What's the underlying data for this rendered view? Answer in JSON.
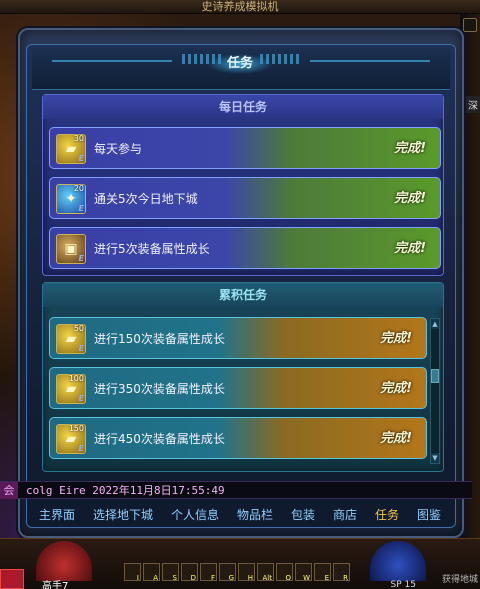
{
  "app": {
    "title": "史诗养成模拟机"
  },
  "panel": {
    "title": "任务"
  },
  "daily": {
    "title": "每日任务",
    "tasks": [
      {
        "icon": "gold-ingot-icon",
        "count": "30",
        "name": "每天参与",
        "status": "完成!"
      },
      {
        "icon": "blue-dungeon-icon",
        "count": "20",
        "name": "通关5次今日地下城",
        "status": "完成!"
      },
      {
        "icon": "equipment-box-icon",
        "count": "",
        "name": "进行5次装备属性成长",
        "status": "完成!"
      }
    ]
  },
  "accum": {
    "title": "累积任务",
    "tasks": [
      {
        "icon": "gold-ingot-icon",
        "count": "50",
        "name": "进行150次装备属性成长",
        "status": "完成!"
      },
      {
        "icon": "gold-ingot-icon",
        "count": "100",
        "name": "进行350次装备属性成长",
        "status": "完成!"
      },
      {
        "icon": "gold-ingot-icon",
        "count": "150",
        "name": "进行450次装备属性成长",
        "status": "完成!"
      }
    ]
  },
  "chat": {
    "tag": "会",
    "message": "colg Eire 2022年11月8日17:55:49"
  },
  "nav": {
    "items": [
      "主界面",
      "选择地下城",
      "个人信息",
      "物品栏",
      "包装",
      "商店",
      "任务",
      "图鉴"
    ],
    "active": "任务"
  },
  "hud": {
    "player": "高手7",
    "sp": "SP 15",
    "right_tag": "深",
    "right_text": "获得地城"
  },
  "colors": {
    "accent": "#f4c64a",
    "nav": "#8fcfff",
    "daily_bg": "#2a3585",
    "accum_bg": "#19455a",
    "chat": "#f6b2f6"
  }
}
